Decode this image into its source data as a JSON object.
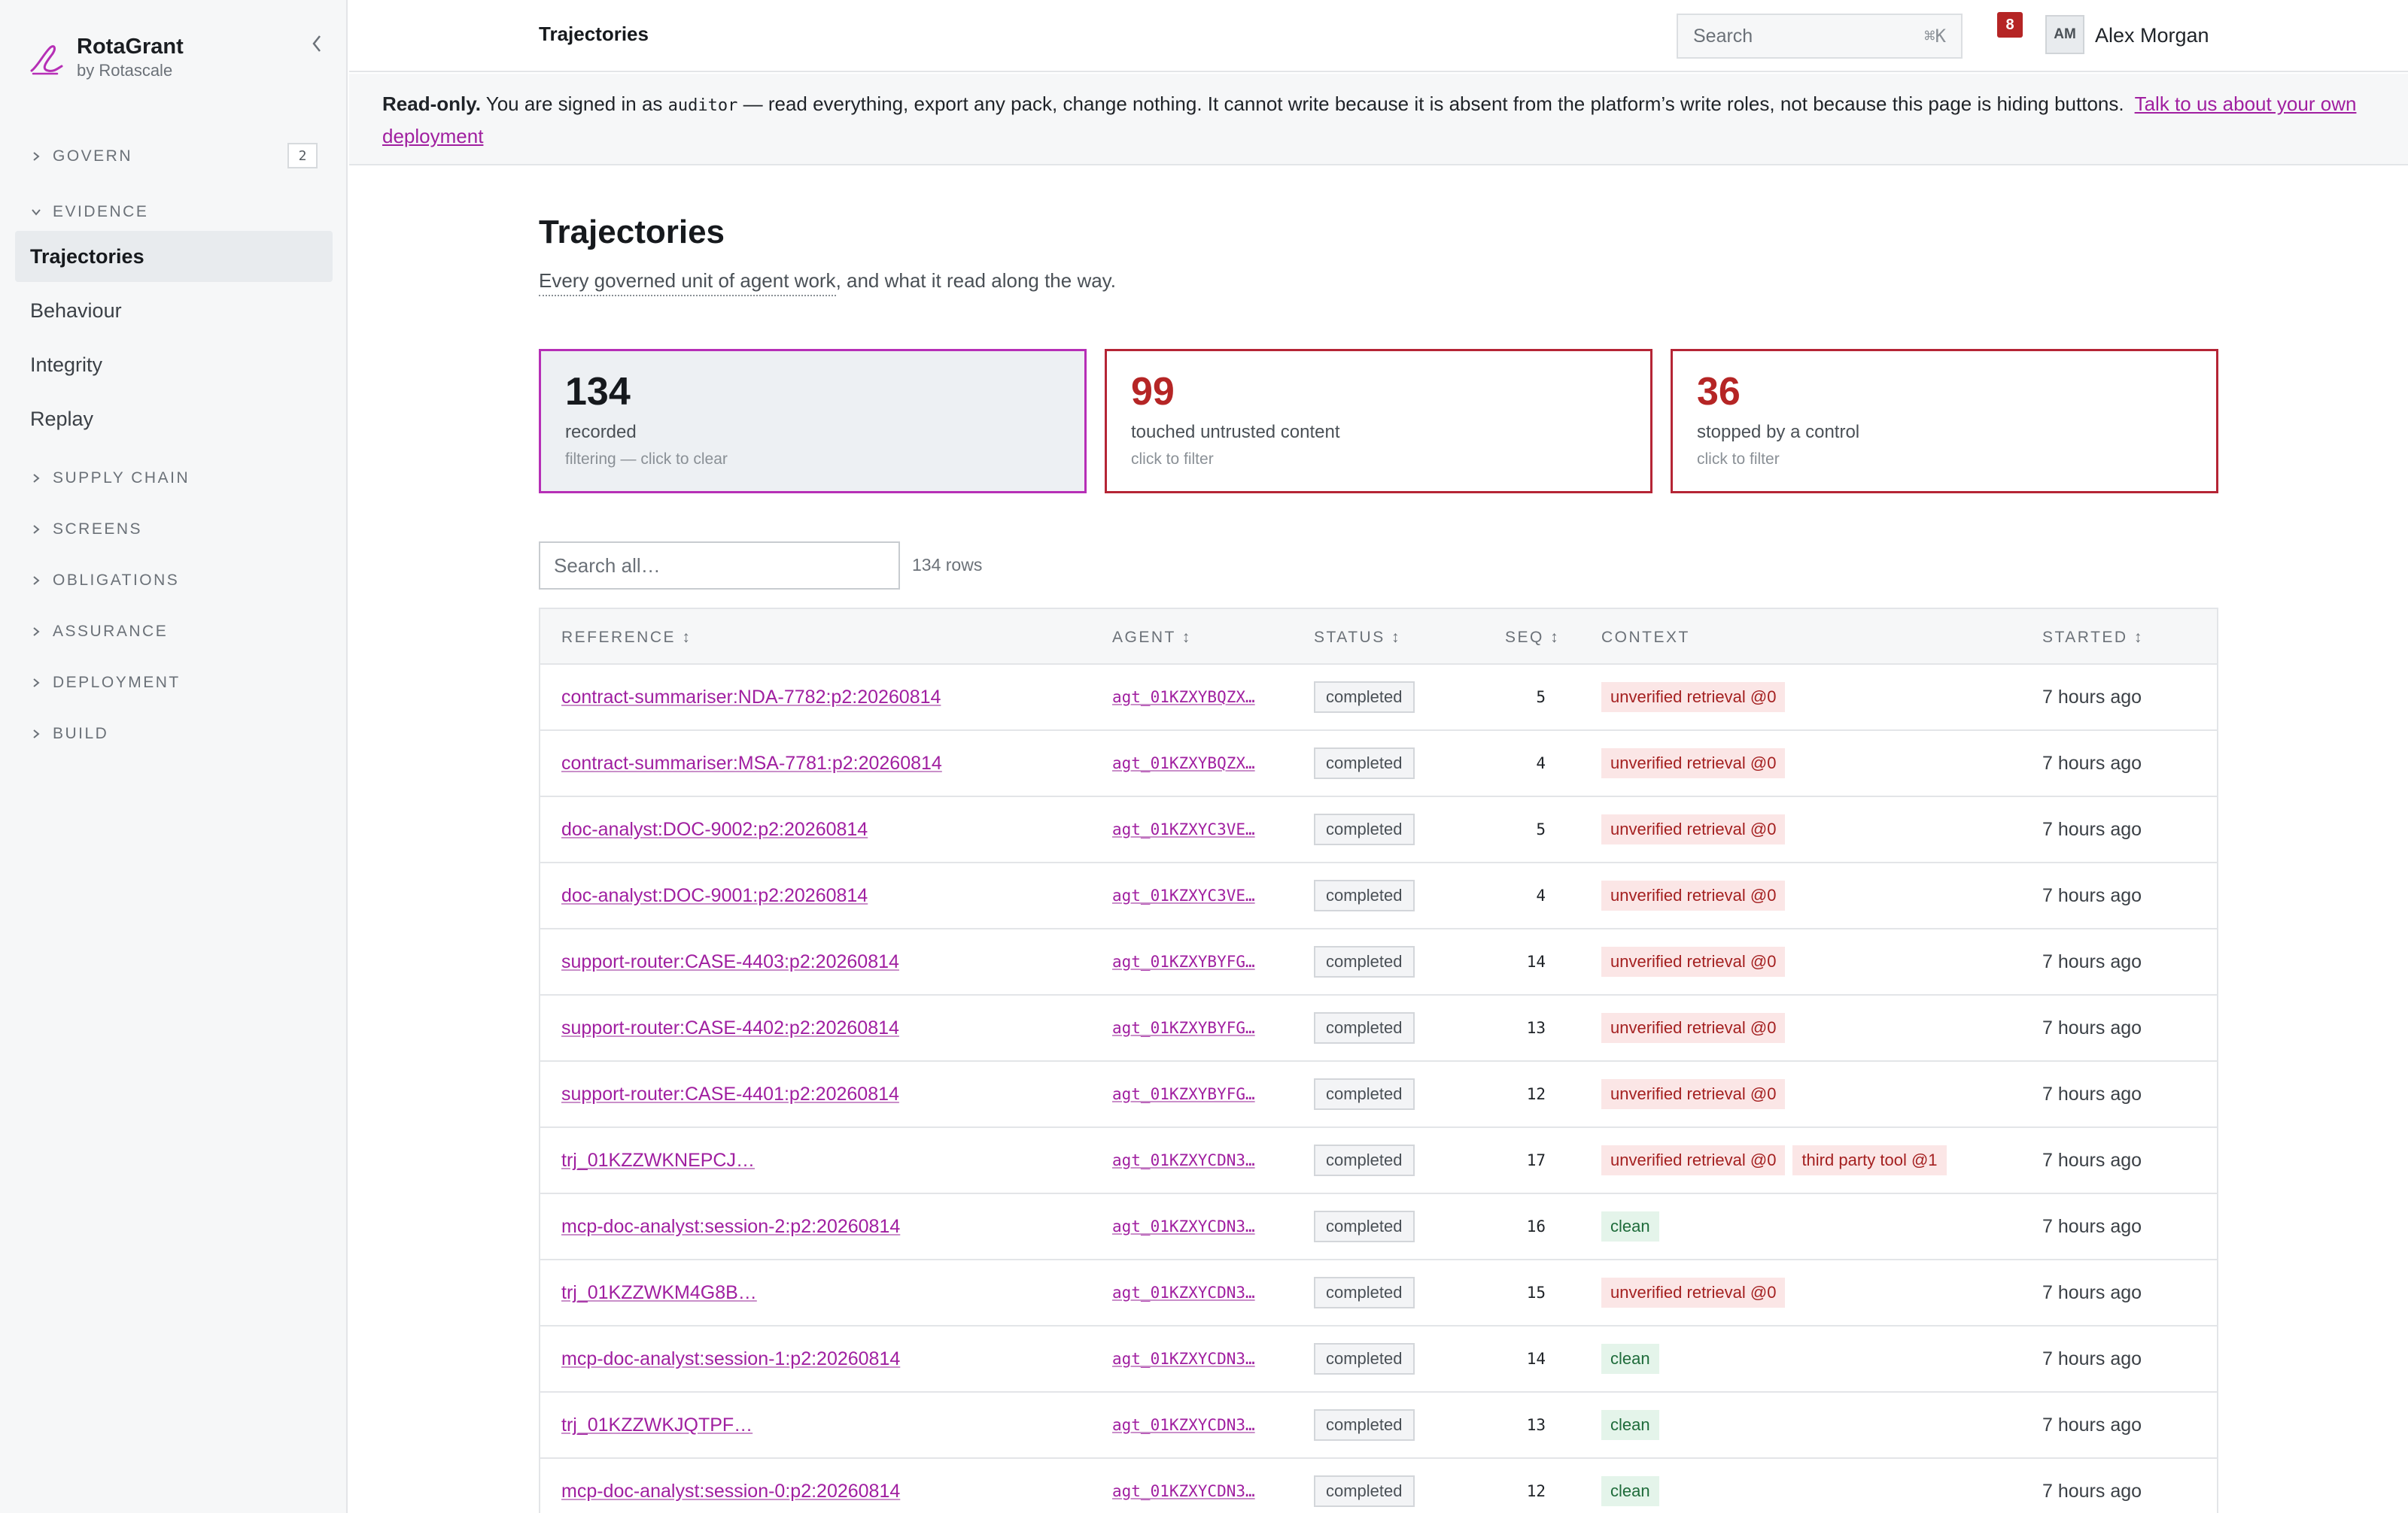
{
  "brand": {
    "name": "RotaGrant",
    "sub": "by Rotascale"
  },
  "sidebar": {
    "sections": [
      {
        "label": "GOVERN",
        "badge": "2"
      },
      {
        "label": "EVIDENCE"
      },
      {
        "label": "SUPPLY CHAIN"
      },
      {
        "label": "SCREENS"
      },
      {
        "label": "OBLIGATIONS"
      },
      {
        "label": "ASSURANCE"
      },
      {
        "label": "DEPLOYMENT"
      },
      {
        "label": "BUILD"
      }
    ],
    "evidence_items": [
      "Trajectories",
      "Behaviour",
      "Integrity",
      "Replay"
    ]
  },
  "topbar": {
    "title": "Trajectories",
    "search_placeholder": "Search",
    "search_shortcut": "⌘K",
    "notifications": "8",
    "avatar": "AM",
    "user": "Alex Morgan"
  },
  "banner": {
    "strong": "Read-only.",
    "pre": "You are signed in as",
    "role": "auditor",
    "text": "— read everything, export any pack, change nothing. It cannot write because it is absent from the platform’s write roles, not because this page is hiding buttons.",
    "link": "Talk to us about your own deployment"
  },
  "page": {
    "title": "Trajectories",
    "subtitle_dotted": "Every governed unit of agent work",
    "subtitle_rest": ", and what it read along the way."
  },
  "stats": [
    {
      "value": "134",
      "label": "recorded",
      "hint": "filtering — click to clear"
    },
    {
      "value": "99",
      "label": "touched untrusted content",
      "hint": "click to filter"
    },
    {
      "value": "36",
      "label": "stopped by a control",
      "hint": "click to filter"
    }
  ],
  "table": {
    "search_placeholder": "Search all…",
    "row_count": "134 rows",
    "columns": {
      "reference": "REFERENCE ↕",
      "agent": "AGENT ↕",
      "status": "STATUS ↕",
      "seq": "SEQ ↕",
      "context": "CONTEXT",
      "started": "STARTED ↕"
    },
    "rows": [
      {
        "ref": "contract-summariser:NDA-7782:p2:20260814",
        "agent": "agt_01KZXYBQZX…",
        "status": "completed",
        "seq": "5",
        "tags": [
          {
            "t": "unverified retrieval @0",
            "k": "warn"
          }
        ],
        "started": "7 hours ago"
      },
      {
        "ref": "contract-summariser:MSA-7781:p2:20260814",
        "agent": "agt_01KZXYBQZX…",
        "status": "completed",
        "seq": "4",
        "tags": [
          {
            "t": "unverified retrieval @0",
            "k": "warn"
          }
        ],
        "started": "7 hours ago"
      },
      {
        "ref": "doc-analyst:DOC-9002:p2:20260814",
        "agent": "agt_01KZXYC3VE…",
        "status": "completed",
        "seq": "5",
        "tags": [
          {
            "t": "unverified retrieval @0",
            "k": "warn"
          }
        ],
        "started": "7 hours ago"
      },
      {
        "ref": "doc-analyst:DOC-9001:p2:20260814",
        "agent": "agt_01KZXYC3VE…",
        "status": "completed",
        "seq": "4",
        "tags": [
          {
            "t": "unverified retrieval @0",
            "k": "warn"
          }
        ],
        "started": "7 hours ago"
      },
      {
        "ref": "support-router:CASE-4403:p2:20260814",
        "agent": "agt_01KZXYBYFG…",
        "status": "completed",
        "seq": "14",
        "tags": [
          {
            "t": "unverified retrieval @0",
            "k": "warn"
          }
        ],
        "started": "7 hours ago"
      },
      {
        "ref": "support-router:CASE-4402:p2:20260814",
        "agent": "agt_01KZXYBYFG…",
        "status": "completed",
        "seq": "13",
        "tags": [
          {
            "t": "unverified retrieval @0",
            "k": "warn"
          }
        ],
        "started": "7 hours ago"
      },
      {
        "ref": "support-router:CASE-4401:p2:20260814",
        "agent": "agt_01KZXYBYFG…",
        "status": "completed",
        "seq": "12",
        "tags": [
          {
            "t": "unverified retrieval @0",
            "k": "warn"
          }
        ],
        "started": "7 hours ago"
      },
      {
        "ref": "trj_01KZZWKNEPCJ…",
        "agent": "agt_01KZXYCDN3…",
        "status": "completed",
        "seq": "17",
        "tags": [
          {
            "t": "unverified retrieval @0",
            "k": "warn"
          },
          {
            "t": "third party tool @1",
            "k": "warn"
          }
        ],
        "started": "7 hours ago"
      },
      {
        "ref": "mcp-doc-analyst:session-2:p2:20260814",
        "agent": "agt_01KZXYCDN3…",
        "status": "completed",
        "seq": "16",
        "tags": [
          {
            "t": "clean",
            "k": "ok"
          }
        ],
        "started": "7 hours ago"
      },
      {
        "ref": "trj_01KZZWKM4G8B…",
        "agent": "agt_01KZXYCDN3…",
        "status": "completed",
        "seq": "15",
        "tags": [
          {
            "t": "unverified retrieval @0",
            "k": "warn"
          }
        ],
        "started": "7 hours ago"
      },
      {
        "ref": "mcp-doc-analyst:session-1:p2:20260814",
        "agent": "agt_01KZXYCDN3…",
        "status": "completed",
        "seq": "14",
        "tags": [
          {
            "t": "clean",
            "k": "ok"
          }
        ],
        "started": "7 hours ago"
      },
      {
        "ref": "trj_01KZZWKJQTPF…",
        "agent": "agt_01KZXYCDN3…",
        "status": "completed",
        "seq": "13",
        "tags": [
          {
            "t": "clean",
            "k": "ok"
          }
        ],
        "started": "7 hours ago"
      },
      {
        "ref": "mcp-doc-analyst:session-0:p2:20260814",
        "agent": "agt_01KZXYCDN3…",
        "status": "completed",
        "seq": "12",
        "tags": [
          {
            "t": "clean",
            "k": "ok"
          }
        ],
        "started": "7 hours ago"
      }
    ]
  }
}
